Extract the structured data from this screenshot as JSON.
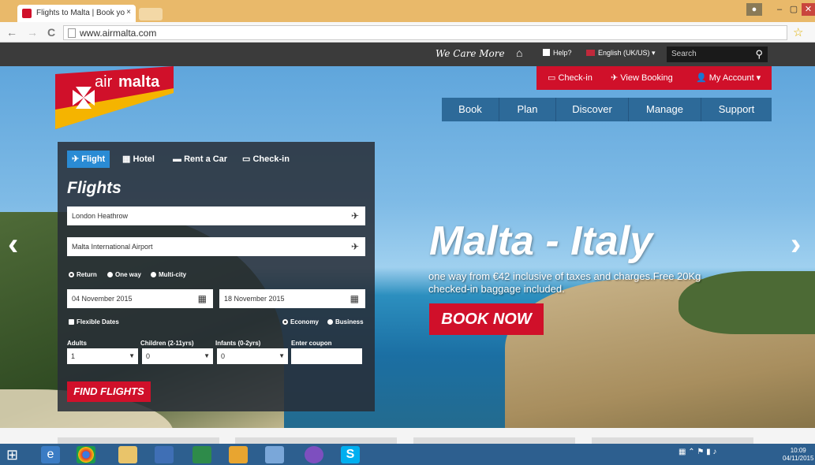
{
  "browser": {
    "tab_title": "Flights to Malta | Book yo",
    "tab_close": "×",
    "url": "www.airmalta.com",
    "back": "←",
    "forward": "→",
    "reload": "C",
    "star": "☆",
    "win_min": "–",
    "win_max": "▢",
    "win_close": "✕"
  },
  "topnav": {
    "tagline": "We Care More",
    "home": "⌂",
    "help": "Help?",
    "language": "English (UK/US) ▾",
    "search_placeholder": "Search",
    "search_icon": "⚲"
  },
  "logo": {
    "text_air": "air",
    "text_malta": "malta"
  },
  "redbar": {
    "checkin": "Check-in",
    "view_booking": "View Booking",
    "my_account": "My Account ▾"
  },
  "mainnav": [
    "Book",
    "Plan",
    "Discover",
    "Manage",
    "Support"
  ],
  "booking": {
    "tabs": [
      "Flight",
      "Hotel",
      "Rent a Car",
      "Check-in"
    ],
    "title": "Flights",
    "from": "London Heathrow",
    "to": "Malta International Airport",
    "trip_types": [
      "Return",
      "One way",
      "Multi-city"
    ],
    "depart_date": "04 November 2015",
    "return_date": "18 November 2015",
    "flexible": "Flexible Dates",
    "cabins": [
      "Economy",
      "Business"
    ],
    "labels": {
      "adults": "Adults",
      "children": "Children (2-11yrs)",
      "infants": "Infants (0-2yrs)",
      "coupon": "Enter coupon"
    },
    "adults": "1",
    "children": "0",
    "infants": "0",
    "find_button": "FIND FLIGHTS"
  },
  "hero": {
    "title": "Malta - Italy",
    "subtitle": "one way from €42 inclusive of taxes and charges.Free 20Kg checked-in baggage included.",
    "cta": "BOOK NOW",
    "prev": "‹",
    "next": "›"
  },
  "taskbar": {
    "time": "10:09",
    "date": "04/11/2015"
  },
  "colors": {
    "brand_red": "#d0102a",
    "nav_blue": "#2d6a99",
    "tab_blue": "#2a8bd4"
  }
}
